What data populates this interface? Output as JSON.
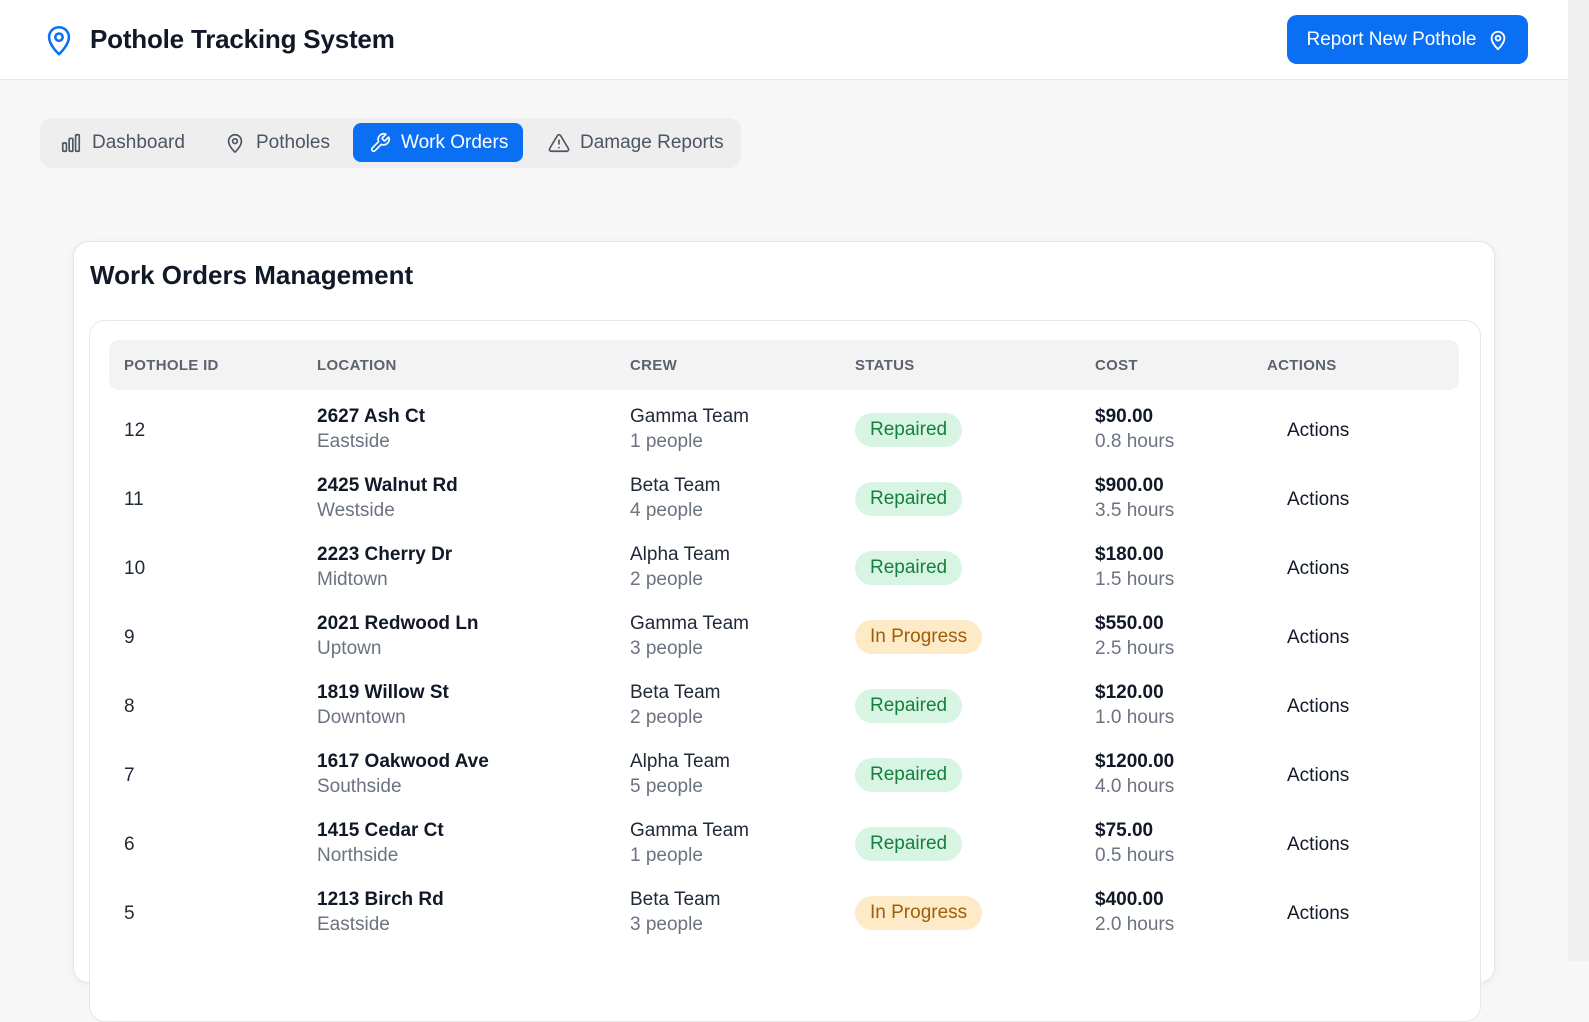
{
  "app": {
    "title": "Pothole Tracking System",
    "report_button_label": "Report New Pothole"
  },
  "nav": {
    "tabs": [
      {
        "label": "Dashboard",
        "icon": "bar-chart-icon",
        "active": false
      },
      {
        "label": "Potholes",
        "icon": "map-pin-icon",
        "active": false
      },
      {
        "label": "Work Orders",
        "icon": "wrench-icon",
        "active": true
      },
      {
        "label": "Damage Reports",
        "icon": "alert-triangle-icon",
        "active": false
      }
    ]
  },
  "main": {
    "title": "Work Orders Management",
    "columns": [
      "POTHOLE ID",
      "LOCATION",
      "CREW",
      "STATUS",
      "COST",
      "ACTIONS"
    ],
    "rows": [
      {
        "id": "12",
        "address": "2627 Ash Ct",
        "area": "Eastside",
        "crew": "Gamma Team",
        "crew_size": "1 people",
        "status": "Repaired",
        "cost": "$90.00",
        "hours": "0.8 hours",
        "action": "Actions"
      },
      {
        "id": "11",
        "address": "2425 Walnut Rd",
        "area": "Westside",
        "crew": "Beta Team",
        "crew_size": "4 people",
        "status": "Repaired",
        "cost": "$900.00",
        "hours": "3.5 hours",
        "action": "Actions"
      },
      {
        "id": "10",
        "address": "2223 Cherry Dr",
        "area": "Midtown",
        "crew": "Alpha Team",
        "crew_size": "2 people",
        "status": "Repaired",
        "cost": "$180.00",
        "hours": "1.5 hours",
        "action": "Actions"
      },
      {
        "id": "9",
        "address": "2021 Redwood Ln",
        "area": "Uptown",
        "crew": "Gamma Team",
        "crew_size": "3 people",
        "status": "In Progress",
        "cost": "$550.00",
        "hours": "2.5 hours",
        "action": "Actions"
      },
      {
        "id": "8",
        "address": "1819 Willow St",
        "area": "Downtown",
        "crew": "Beta Team",
        "crew_size": "2 people",
        "status": "Repaired",
        "cost": "$120.00",
        "hours": "1.0 hours",
        "action": "Actions"
      },
      {
        "id": "7",
        "address": "1617 Oakwood Ave",
        "area": "Southside",
        "crew": "Alpha Team",
        "crew_size": "5 people",
        "status": "Repaired",
        "cost": "$1200.00",
        "hours": "4.0 hours",
        "action": "Actions"
      },
      {
        "id": "6",
        "address": "1415 Cedar Ct",
        "area": "Northside",
        "crew": "Gamma Team",
        "crew_size": "1 people",
        "status": "Repaired",
        "cost": "$75.00",
        "hours": "0.5 hours",
        "action": "Actions"
      },
      {
        "id": "5",
        "address": "1213 Birch Rd",
        "area": "Eastside",
        "crew": "Beta Team",
        "crew_size": "3 people",
        "status": "In Progress",
        "cost": "$400.00",
        "hours": "2.0 hours",
        "action": "Actions"
      }
    ]
  },
  "colors": {
    "accent": "#0b6ff3",
    "repaired_bg": "#d8f5e3",
    "repaired_text": "#15803d",
    "progress_bg": "#fdebc8",
    "progress_text": "#a15c07"
  }
}
